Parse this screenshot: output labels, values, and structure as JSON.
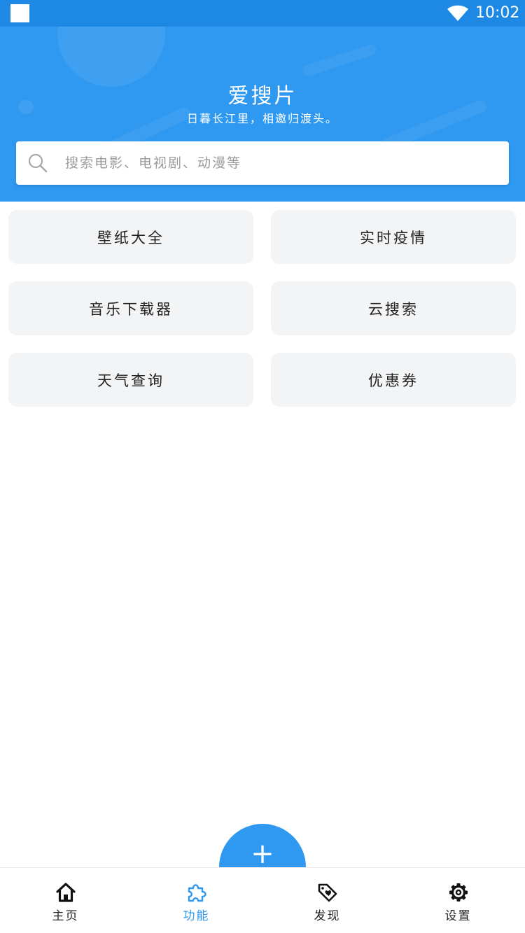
{
  "status_bar": {
    "time": "10:02"
  },
  "header": {
    "title": "爱搜片",
    "subtitle": "日暮长江里，相邀归渡头。"
  },
  "search": {
    "placeholder": "搜索电影、电视剧、动漫等",
    "value": ""
  },
  "features": [
    {
      "label": "壁纸大全"
    },
    {
      "label": "实时疫情"
    },
    {
      "label": "音乐下载器"
    },
    {
      "label": "云搜索"
    },
    {
      "label": "天气查询"
    },
    {
      "label": "优惠券"
    }
  ],
  "fab": {
    "icon": "plus-icon"
  },
  "bottom_nav": {
    "active_index": 1,
    "items": [
      {
        "label": "主页",
        "icon": "home-icon"
      },
      {
        "label": "功能",
        "icon": "puzzle-icon"
      },
      {
        "label": "发现",
        "icon": "tag-heart-icon"
      },
      {
        "label": "设置",
        "icon": "gear-icon"
      }
    ]
  },
  "colors": {
    "primary": "#2f98f0",
    "status_bar": "#1e88e5",
    "card_bg": "#f3f4f6",
    "text": "#222222"
  }
}
